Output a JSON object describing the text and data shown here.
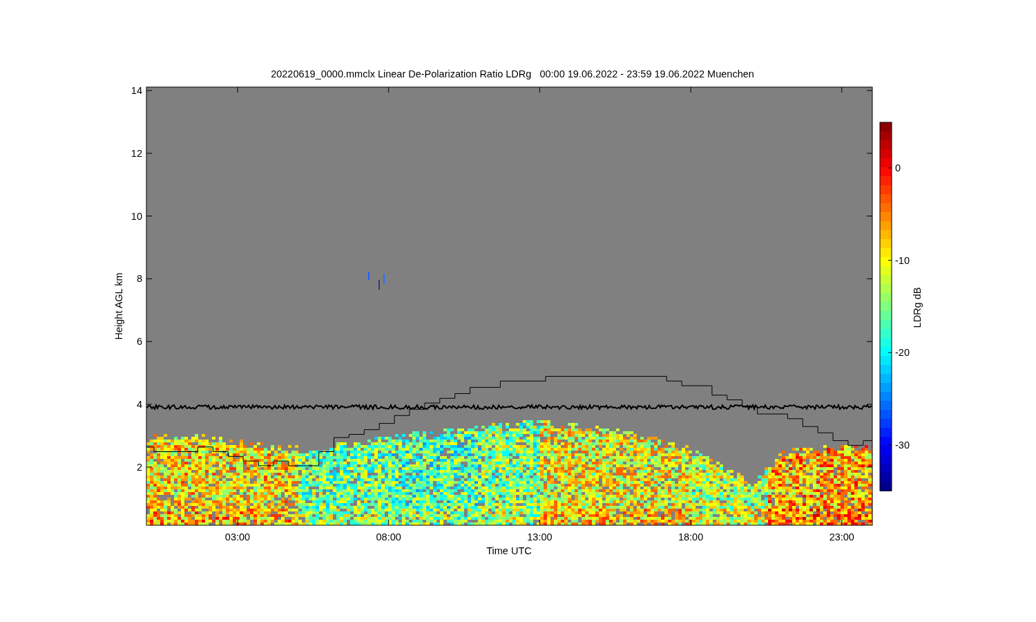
{
  "title": "20220619_0000.mmclx Linear De-Polarization Ratio LDRg   00:00 19.06.2022 - 23:59 19.06.2022 Muenchen",
  "y_axis": {
    "label": "Height AGL km",
    "ticks": [
      "14",
      "12",
      "10",
      "8",
      "6",
      "4",
      "2"
    ]
  },
  "x_axis": {
    "label": "Time UTC",
    "ticks": [
      "03:00",
      "08:00",
      "13:00",
      "18:00",
      "23:00"
    ]
  },
  "colorbar": {
    "label": "LDRg dB",
    "ticks": [
      "0",
      "-10",
      "-20",
      "-30"
    ]
  }
}
